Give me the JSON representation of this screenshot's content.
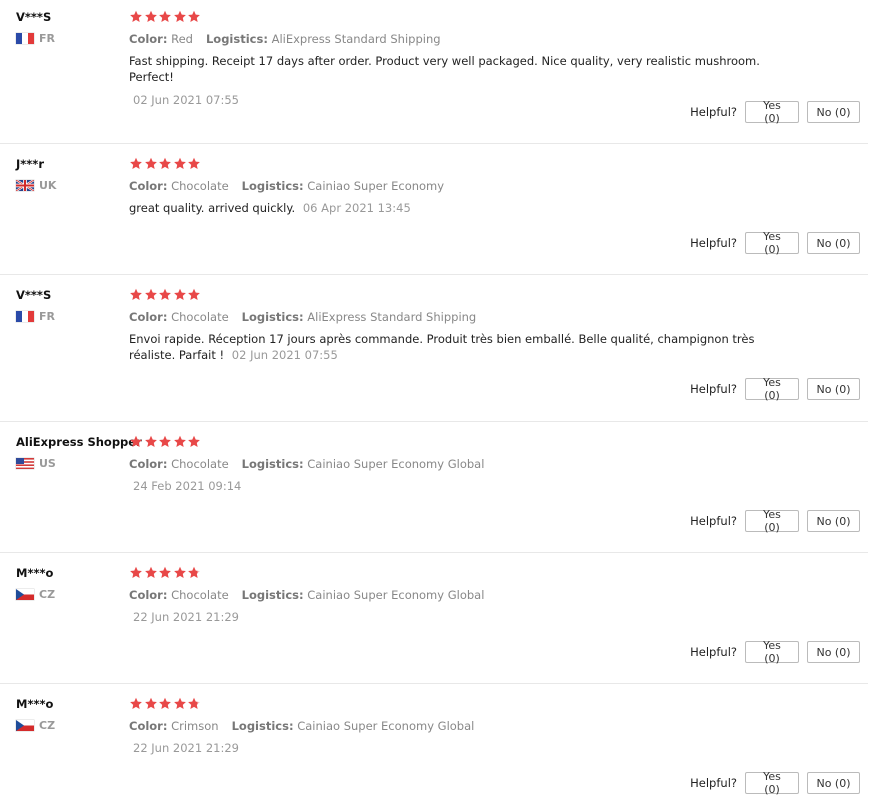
{
  "colors": {
    "star": "#e84848",
    "separator": "#e8e8e8",
    "muted": "#888888"
  },
  "labels": {
    "color": "Color:",
    "logistics": "Logistics:",
    "helpful": "Helpful?"
  },
  "reviews": [
    {
      "user": "V***S",
      "flag_icon": "france-flag-icon",
      "country": "FR",
      "stars": 5,
      "color": "Red",
      "logistics": "AliExpress Standard Shipping",
      "text": "Fast shipping. Receipt 17 days after order. Product very well packaged. Nice quality, very realistic mushroom. Perfect!",
      "date": "02 Jun 2021 07:55",
      "yes": "Yes (0)",
      "no": "No (0)"
    },
    {
      "user": "J***r",
      "flag_icon": "uk-flag-icon",
      "country": "UK",
      "stars": 5,
      "color": "Chocolate",
      "logistics": "Cainiao Super Economy",
      "text": "great quality. arrived quickly.",
      "date": "06 Apr 2021 13:45",
      "yes": "Yes (0)",
      "no": "No (0)"
    },
    {
      "user": "V***S",
      "flag_icon": "france-flag-icon",
      "country": "FR",
      "stars": 5,
      "color": "Chocolate",
      "logistics": "AliExpress Standard Shipping",
      "text": "Envoi rapide. Réception 17 jours après commande. Produit très bien emballé. Belle qualité, champignon très réaliste. Parfait !",
      "date": "02 Jun 2021 07:55",
      "yes": "Yes (0)",
      "no": "No (0)"
    },
    {
      "user": "AliExpress Shopper",
      "flag_icon": "us-flag-icon",
      "country": "US",
      "stars": 5,
      "color": "Chocolate",
      "logistics": "Cainiao Super Economy Global",
      "text": "",
      "date": "24 Feb 2021 09:14",
      "yes": "Yes (0)",
      "no": "No (0)"
    },
    {
      "user": "M***o",
      "flag_icon": "czech-flag-icon",
      "country": "CZ",
      "stars": 4.8,
      "color": "Chocolate",
      "logistics": "Cainiao Super Economy Global",
      "text": "",
      "date": "22 Jun 2021 21:29",
      "yes": "Yes (0)",
      "no": "No (0)"
    },
    {
      "user": "M***o",
      "flag_icon": "czech-flag-icon",
      "country": "CZ",
      "stars": 4.8,
      "color": "Crimson",
      "logistics": "Cainiao Super Economy Global",
      "text": "",
      "date": "22 Jun 2021 21:29",
      "yes": "Yes (0)",
      "no": "No (0)"
    }
  ]
}
